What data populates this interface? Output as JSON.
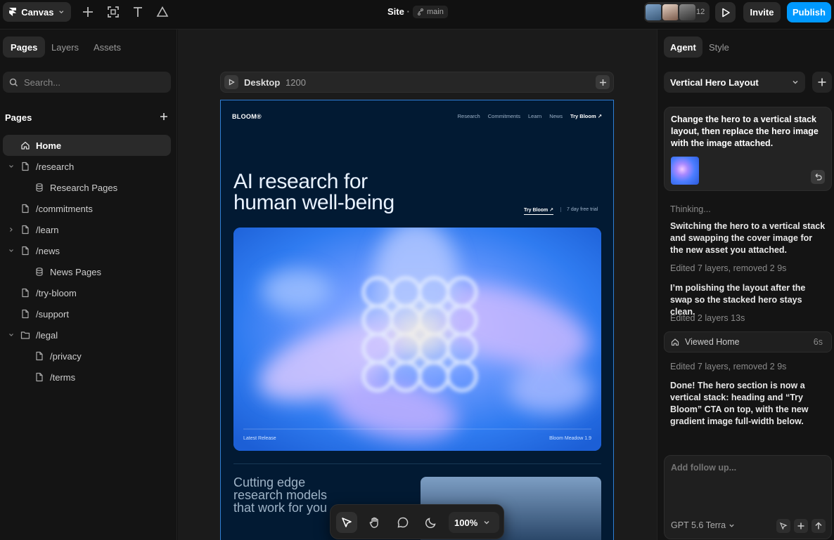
{
  "app": {
    "name": "Canvas"
  },
  "header": {
    "site_title": "Site",
    "separator": "·",
    "branch": "main",
    "collaborator_count": "12",
    "invite_label": "Invite",
    "publish_label": "Publish"
  },
  "left": {
    "tabs": [
      "Pages",
      "Layers",
      "Assets"
    ],
    "search_placeholder": "Search...",
    "pages_header": "Pages",
    "tree": [
      {
        "label": "Home",
        "icon": "home-icon",
        "indent": 0,
        "chevron": "",
        "active": true
      },
      {
        "label": "/research",
        "icon": "page-icon",
        "indent": 0,
        "chevron": "down"
      },
      {
        "label": "Research Pages",
        "icon": "database-icon",
        "indent": 1,
        "chevron": ""
      },
      {
        "label": "/commitments",
        "icon": "page-icon",
        "indent": 0,
        "chevron": ""
      },
      {
        "label": "/learn",
        "icon": "page-icon",
        "indent": 0,
        "chevron": "right"
      },
      {
        "label": "/news",
        "icon": "page-icon",
        "indent": 0,
        "chevron": "down"
      },
      {
        "label": "News Pages",
        "icon": "database-icon",
        "indent": 1,
        "chevron": ""
      },
      {
        "label": "/try-bloom",
        "icon": "page-icon",
        "indent": 0,
        "chevron": ""
      },
      {
        "label": "/support",
        "icon": "page-icon",
        "indent": 0,
        "chevron": ""
      },
      {
        "label": "/legal",
        "icon": "folder-icon",
        "indent": 0,
        "chevron": "down"
      },
      {
        "label": "/privacy",
        "icon": "page-icon",
        "indent": 1,
        "chevron": ""
      },
      {
        "label": "/terms",
        "icon": "page-icon",
        "indent": 1,
        "chevron": ""
      }
    ]
  },
  "canvas": {
    "frame_name": "Desktop",
    "frame_width": "1200",
    "zoom": "100%",
    "site": {
      "logo": "BLOOM®",
      "nav": [
        "Research",
        "Commitments",
        "Learn",
        "News",
        "Try Bloom ↗"
      ],
      "hero_line1": "AI research for",
      "hero_line2": "human well-being",
      "cta": "Try Bloom ↗",
      "cta_sub": "7 day free trial",
      "image_left_label": "Latest Release",
      "image_right_label": "Bloom Meadow 1.9",
      "section2_text": "Cutting edge research models that work for you"
    }
  },
  "right": {
    "tabs": [
      "Agent",
      "Style"
    ],
    "thread_title": "Vertical Hero Layout",
    "user_message": "Change the hero to a vertical stack layout, then replace the hero image with the image attached.",
    "thinking": "Thinking...",
    "reply1": "Switching the hero to a vertical stack and swapping the cover image for the new asset you attached.",
    "status1": "Edited 7 layers, removed 2",
    "status1_time": "9s",
    "reply2": "I’m polishing the layout after the swap so the stacked hero stays clean.",
    "status2": "Edited 2 layers",
    "status2_time": "13s",
    "viewed_label": "Viewed Home",
    "viewed_time": "6s",
    "status3": "Edited 7 layers, removed 2",
    "status3_time": "9s",
    "reply3": "Done! The hero section is now a vertical stack: heading and “Try Bloom” CTA on top, with the new gradient image full-width below.",
    "composer_placeholder": "Add follow up...",
    "model": "GPT 5.6 Terra"
  },
  "colors": {
    "accent": "#0099ff",
    "site_bg": "#021a33",
    "selection": "#2f7fd6"
  }
}
